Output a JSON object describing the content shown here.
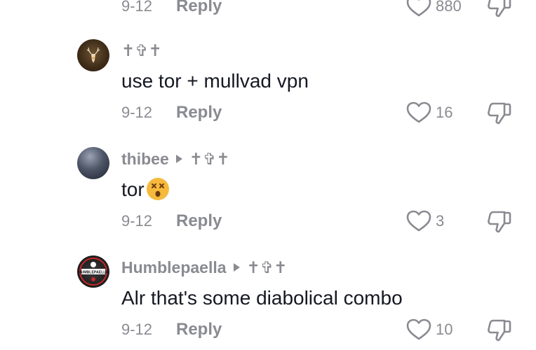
{
  "top_partial": {
    "date": "9-12",
    "reply_label": "Reply",
    "likes": "880"
  },
  "comments": [
    {
      "author": "✝︎✞✝︎",
      "reply_to": "",
      "text": "use tor + mullvad vpn",
      "date": "9-12",
      "reply_label": "Reply",
      "likes": "16",
      "avatar_icon": "deer-icon"
    },
    {
      "author": "thibee",
      "reply_to": "✝︎✞✝︎",
      "text": "tor",
      "emoji": "dizzy-face-emoji",
      "date": "9-12",
      "reply_label": "Reply",
      "likes": "3",
      "avatar_icon": "blurred-photo"
    },
    {
      "author": "Humblepaella",
      "reply_to": "✝︎✞✝︎",
      "text": "Alr that's some diabolical combo",
      "date": "9-12",
      "reply_label": "Reply",
      "likes": "10",
      "avatar_icon": "club-badge-icon",
      "avatar_text": "HUMBLEPAELLA"
    }
  ],
  "colors": {
    "text": "#161823",
    "muted": "#8a8b91",
    "background": "#ffffff",
    "emoji": "#f6b93b"
  }
}
